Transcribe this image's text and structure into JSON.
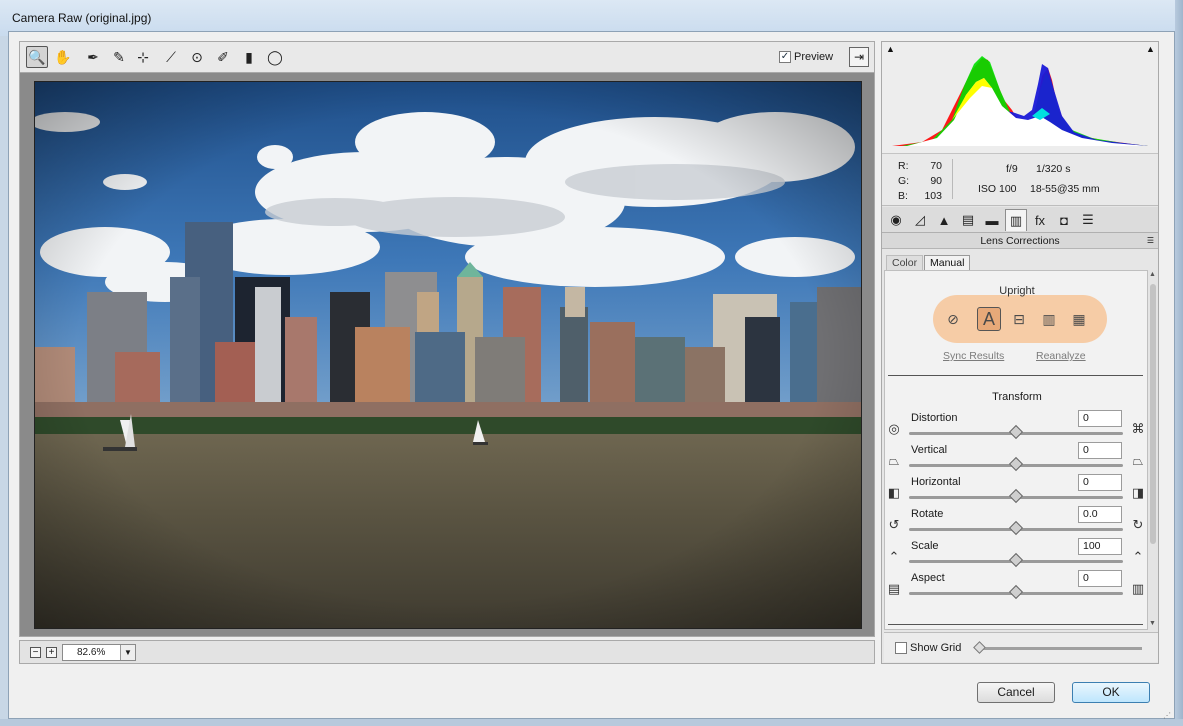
{
  "window": {
    "title": "Camera Raw (original.jpg)"
  },
  "toolbar": {
    "tools": [
      {
        "name": "zoom-tool-icon",
        "glyph": "🔍",
        "active": true
      },
      {
        "name": "hand-tool-icon",
        "glyph": "✋"
      },
      {
        "name": "white-balance-tool-icon",
        "glyph": "✒"
      },
      {
        "name": "color-sampler-tool-icon",
        "glyph": "✎"
      },
      {
        "name": "targeted-adjustment-tool-icon",
        "glyph": "⊹"
      },
      {
        "name": "straighten-tool-icon",
        "glyph": "⟋"
      },
      {
        "name": "red-eye-removal-icon",
        "glyph": "⊙"
      },
      {
        "name": "adjustment-brush-icon",
        "glyph": "✐"
      },
      {
        "name": "graduated-filter-icon",
        "glyph": "▮"
      },
      {
        "name": "radial-filter-icon",
        "glyph": "◯"
      }
    ],
    "preview_label": "Preview",
    "preview_checked": "✓",
    "fullscreen_glyph": "⇥"
  },
  "zoom": {
    "minus": "−",
    "plus": "+",
    "value": "82.6%",
    "arrow": "▼"
  },
  "histogram": {
    "clip_left": "▲",
    "clip_right": "▲"
  },
  "info": {
    "r_label": "R:",
    "r": "70",
    "g_label": "G:",
    "g": "90",
    "b_label": "B:",
    "b": "103",
    "aperture": "f/9",
    "shutter": "1/320 s",
    "iso": "ISO 100",
    "lens": "18-55@35 mm"
  },
  "panel_tabs": [
    {
      "name": "basic-tab-icon",
      "glyph": "◉"
    },
    {
      "name": "tone-curve-tab-icon",
      "glyph": "◿"
    },
    {
      "name": "detail-tab-icon",
      "glyph": "▲"
    },
    {
      "name": "hsl-tab-icon",
      "glyph": "▤"
    },
    {
      "name": "split-toning-tab-icon",
      "glyph": "▬"
    },
    {
      "name": "lens-corrections-tab-icon",
      "glyph": "▥",
      "active": true
    },
    {
      "name": "effects-tab-icon",
      "glyph": "fx"
    },
    {
      "name": "camera-calibration-tab-icon",
      "glyph": "◘"
    },
    {
      "name": "presets-tab-icon",
      "glyph": "☰"
    }
  ],
  "section": {
    "title": "Lens Corrections",
    "menu_glyph": "☰"
  },
  "subtabs": {
    "color": "Color",
    "manual": "Manual"
  },
  "upright": {
    "title": "Upright",
    "buttons": [
      {
        "name": "upright-off-icon",
        "glyph": "⊘"
      },
      {
        "name": "upright-auto-icon",
        "glyph": "A",
        "active": true
      },
      {
        "name": "upright-level-icon",
        "glyph": "⊟"
      },
      {
        "name": "upright-vertical-icon",
        "glyph": "▥"
      },
      {
        "name": "upright-full-icon",
        "glyph": "▦"
      }
    ],
    "sync_results": "Sync Results",
    "reanalyze": "Reanalyze"
  },
  "transform": {
    "title": "Transform",
    "sliders": [
      {
        "label": "Distortion",
        "value": "0",
        "left_icon": "◎",
        "right_icon": "⌘",
        "position": 0.5
      },
      {
        "label": "Vertical",
        "value": "0",
        "left_icon": "⏢",
        "right_icon": "⏢",
        "position": 0.5
      },
      {
        "label": "Horizontal",
        "value": "0",
        "left_icon": "◧",
        "right_icon": "◨",
        "position": 0.5
      },
      {
        "label": "Rotate",
        "value": "0.0",
        "left_icon": "↺",
        "right_icon": "↻",
        "position": 0.5
      },
      {
        "label": "Scale",
        "value": "100",
        "left_icon": "⌃",
        "right_icon": "⌃",
        "position": 0.5
      },
      {
        "label": "Aspect",
        "value": "0",
        "left_icon": "▤",
        "right_icon": "▥",
        "position": 0.5
      }
    ]
  },
  "show_grid": {
    "label": "Show Grid"
  },
  "buttons": {
    "cancel": "Cancel",
    "ok": "OK"
  },
  "colors": {
    "highlight": "#f6c9a0",
    "ok_border": "#3c7fb1"
  }
}
